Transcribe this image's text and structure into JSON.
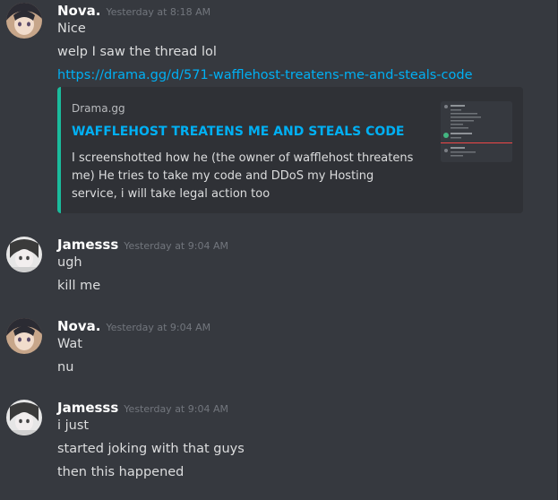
{
  "messages": [
    {
      "username": "Nova.",
      "timestamp": "Yesterday at 8:18 AM",
      "lines": [
        "Nice",
        "welp I saw the thread lol"
      ],
      "link": "https://drama.gg/d/571-wafflehost-treatens-me-and-steals-code"
    },
    {
      "username": "Jamesss",
      "timestamp": "Yesterday at 9:04 AM",
      "lines": [
        "ugh",
        "kill me"
      ]
    },
    {
      "username": "Nova.",
      "timestamp": "Yesterday at 9:04 AM",
      "lines": [
        "Wat",
        "nu"
      ]
    },
    {
      "username": "Jamesss",
      "timestamp": "Yesterday at 9:04 AM",
      "lines": [
        "i just",
        "started joking with that guys",
        "then this happened"
      ]
    }
  ],
  "embed": {
    "provider": "Drama.gg",
    "title": "WAFFLEHOST TREATENS ME AND STEALS CODE",
    "description": "I screenshotted how he (the owner of wafflehost threatens me) He tries to take my code and DDoS my Hosting service, i will take legal action too"
  },
  "colors": {
    "background": "#36393f",
    "link": "#00b0f4",
    "embed_border": "#1abc9c"
  }
}
